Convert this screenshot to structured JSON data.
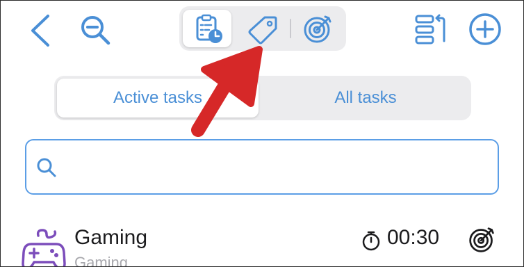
{
  "toolbar": {
    "back_icon": "chevron-left-icon",
    "zoom_icon": "zoom-out-icon",
    "modes": [
      {
        "icon": "clipboard-clock-icon",
        "selected": true
      },
      {
        "icon": "tag-icon",
        "selected": false
      },
      {
        "icon": "target-icon",
        "selected": false
      }
    ],
    "reorder_icon": "reorder-icon",
    "add_icon": "plus-circle-icon"
  },
  "tabs": {
    "active_label": "Active tasks",
    "all_label": "All tasks",
    "selected": "Active tasks"
  },
  "search": {
    "placeholder": "",
    "value": ""
  },
  "tasks": [
    {
      "title": "Gaming",
      "category": "Gaming",
      "time": "00:30",
      "icon": "gamepad-icon"
    }
  ],
  "colors": {
    "accent": "#4a8fd6",
    "annotation_arrow": "#d62828",
    "task_icon": "#7c4dbb"
  }
}
